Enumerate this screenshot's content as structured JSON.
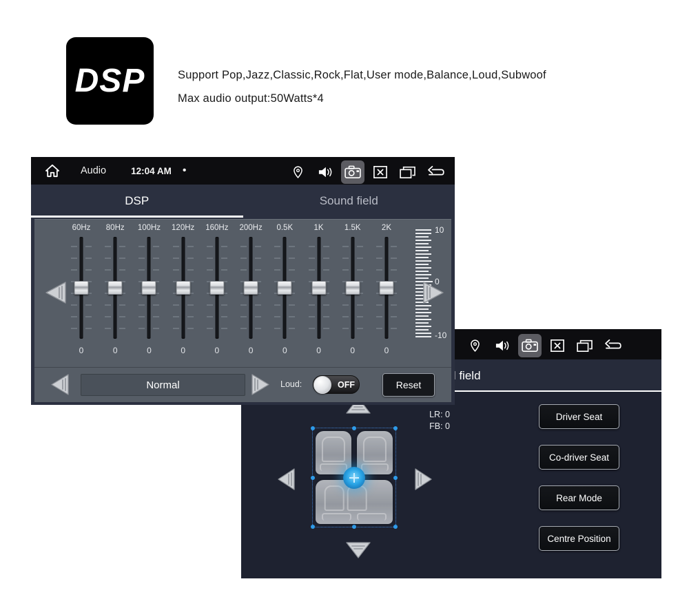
{
  "product": {
    "logo_text": "DSP",
    "description_line1": "Support Pop,Jazz,Classic,Rock,Flat,User mode,Balance,Loud,Subwoof",
    "description_line2": "Max audio output:50Watts*4"
  },
  "dsp_screen": {
    "status_bar": {
      "home_icon": "home-icon",
      "app_label": "Audio",
      "time": "12:04 AM",
      "dot": "•",
      "icons": [
        {
          "name": "location-icon",
          "active": false
        },
        {
          "name": "volume-icon",
          "active": false
        },
        {
          "name": "screenshot-camera-icon",
          "active": true
        },
        {
          "name": "close-box-icon",
          "active": false
        },
        {
          "name": "recent-apps-icon",
          "active": false
        },
        {
          "name": "back-icon",
          "active": false
        }
      ]
    },
    "tabs": [
      {
        "label": "DSP",
        "active": true
      },
      {
        "label": "Sound field",
        "active": false
      }
    ],
    "equalizer": {
      "scale_labels": [
        "10",
        "0",
        "-10"
      ],
      "bands": [
        {
          "label": "60Hz",
          "value": "0"
        },
        {
          "label": "80Hz",
          "value": "0"
        },
        {
          "label": "100Hz",
          "value": "0"
        },
        {
          "label": "120Hz",
          "value": "0"
        },
        {
          "label": "160Hz",
          "value": "0"
        },
        {
          "label": "200Hz",
          "value": "0"
        },
        {
          "label": "0.5K",
          "value": "0"
        },
        {
          "label": "1K",
          "value": "0"
        },
        {
          "label": "1.5K",
          "value": "0"
        },
        {
          "label": "2K",
          "value": "0"
        }
      ]
    },
    "footer": {
      "preset_prev_icon": "arrow-left-icon",
      "preset_value": "Normal",
      "preset_next_icon": "arrow-right-icon",
      "loud_label": "Loud:",
      "loud_state": "OFF",
      "reset_label": "Reset"
    }
  },
  "sound_field_screen": {
    "status_bar": {
      "icons": [
        {
          "name": "location-icon",
          "active": false
        },
        {
          "name": "volume-icon",
          "active": false
        },
        {
          "name": "screenshot-camera-icon",
          "active": true
        },
        {
          "name": "close-box-icon",
          "active": false
        },
        {
          "name": "recent-apps-icon",
          "active": false
        },
        {
          "name": "back-icon",
          "active": false
        }
      ]
    },
    "tab_label": "Sound field",
    "readouts": {
      "lr": "LR: 0",
      "fb": "FB: 0"
    },
    "seats": [
      "front-left-seat",
      "front-right-seat",
      "rear-bench-seat"
    ],
    "pad": {
      "up_icon": "arrow-up-icon",
      "down_icon": "arrow-down-icon",
      "left_icon": "arrow-left-icon",
      "right_icon": "arrow-right-icon",
      "center_icon": "balance-crosshair-icon"
    },
    "preset_buttons": [
      {
        "label": "Driver Seat"
      },
      {
        "label": "Co-driver Seat"
      },
      {
        "label": "Rear Mode"
      },
      {
        "label": "Centre Position"
      }
    ]
  },
  "colors": {
    "page_background": "#ffffff",
    "status_bar": "#0d0d10",
    "tab_bar": "#2b3040",
    "eq_panel": "#565d66",
    "sound_field_panel": "#1e2230",
    "accent_blue": "#2aa5e6",
    "text_primary": "#ffffff"
  }
}
